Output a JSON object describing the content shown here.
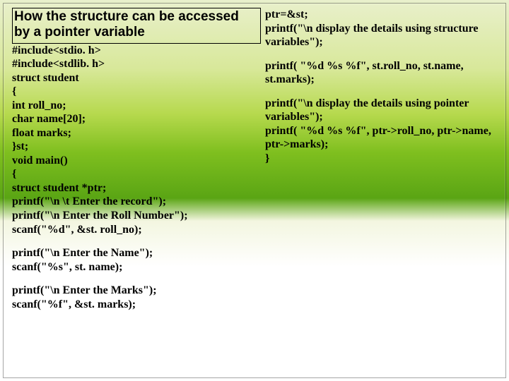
{
  "left": {
    "title": "How the structure can be accessed by a pointer variable",
    "lines": [
      "#include<stdio. h>",
      "#include<stdlib. h>",
      "struct student",
      "{",
      "int roll_no;",
      "char name[20];",
      "float marks;",
      "}st;",
      "void main()",
      "{",
      "struct student *ptr;",
      "printf(\"\\n \\t Enter the record\");",
      "printf(\"\\n Enter the Roll Number\");",
      "scanf(\"%d\", &st. roll_no);"
    ],
    "block2": [
      "printf(\"\\n Enter the Name\");",
      "scanf(\"%s\", st. name);"
    ],
    "block3": [
      "printf(\"\\n Enter the Marks\");",
      "scanf(\"%f\", &st. marks);"
    ]
  },
  "right": {
    "block1": [
      "ptr=&st;",
      "printf(\"\\n display the details using structure variables\");"
    ],
    "block2": [
      "printf( \"%d %s %f\", st.roll_no, st.name, st.marks);"
    ],
    "block3": [
      "printf(\"\\n display the details using pointer variables\");",
      "printf( \"%d %s %f\", ptr->roll_no, ptr->name, ptr->marks);",
      "}"
    ]
  }
}
